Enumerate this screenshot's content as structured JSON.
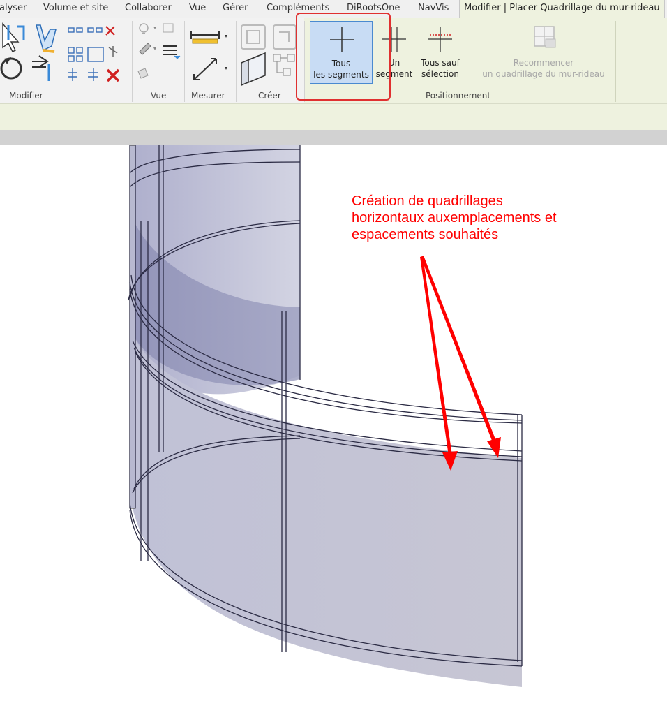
{
  "tabs": [
    {
      "label": "alyser"
    },
    {
      "label": "Volume et site"
    },
    {
      "label": "Collaborer"
    },
    {
      "label": "Vue"
    },
    {
      "label": "Gérer"
    },
    {
      "label": "Compléments"
    },
    {
      "label": "DiRootsOne"
    },
    {
      "label": "NavVis"
    },
    {
      "label": "Modifier | Placer Quadrillage du mur-rideau"
    }
  ],
  "panels": {
    "modifier": "Modifier",
    "vue": "Vue",
    "mesurer": "Mesurer",
    "creer": "Créer",
    "positionnement": "Positionnement"
  },
  "buttons": {
    "tous_line1": "Tous",
    "tous_line2": "les segments",
    "un_line1": "Un",
    "un_line2": "segment",
    "tous_sauf_line1": "Tous sauf",
    "tous_sauf_line2": "sélection",
    "recommencer_line1": "Recommencer",
    "recommencer_line2": "un quadrillage du mur-rideau"
  },
  "annotation": {
    "text": "Création de quadrillages\nhorizontaux auxemplacements et\nespacements souhaités"
  },
  "colors": {
    "annotation": "#ff0000",
    "highlight": "#e03030",
    "ribbon_context": "#eef2df",
    "selected_button": "#c8dcf4",
    "wall_fill": "#a9a9c8"
  },
  "icons": {
    "modify_select": "cursor-arrow-icon",
    "align": "align-icon",
    "rotate": "rotate-icon",
    "trim": "trim-icon",
    "measure": "measure-icon",
    "create_group": "create-group-icon",
    "grid_all": "grid-line-icon",
    "grid_one": "grid-line-icon",
    "grid_except": "grid-line-icon",
    "recommence": "recommence-grid-icon"
  }
}
